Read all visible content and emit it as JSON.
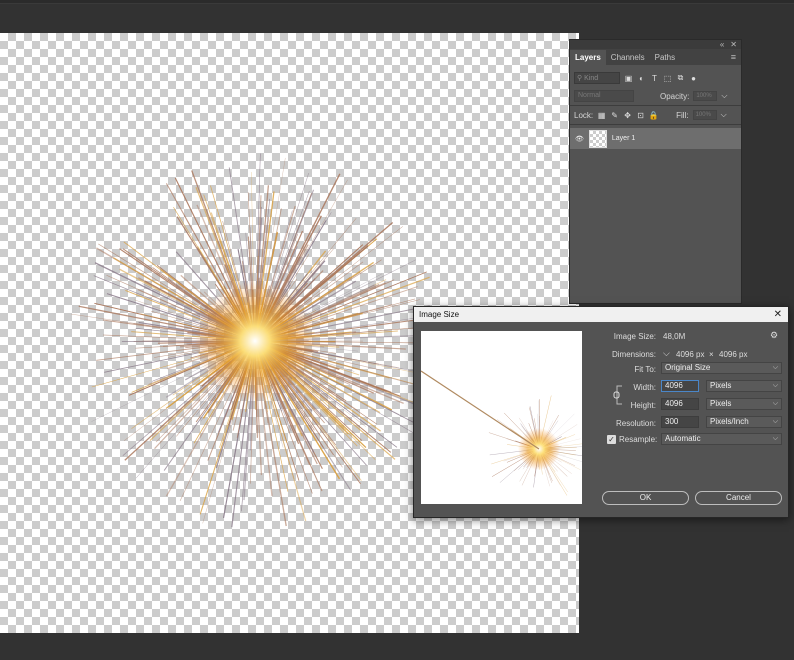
{
  "layers_panel": {
    "tabs": [
      "Layers",
      "Channels",
      "Paths"
    ],
    "kind_placeholder": "Kind",
    "blend_mode": "Normal",
    "opacity_label": "Opacity:",
    "opacity_value": "100%",
    "lock_label": "Lock:",
    "fill_label": "Fill:",
    "fill_value": "100%",
    "layer_name": "Layer 1"
  },
  "dialog": {
    "title": "Image Size",
    "image_size_label": "Image Size:",
    "image_size_value": "48,0M",
    "dimensions_label": "Dimensions:",
    "dimensions_w": "4096 px",
    "dimensions_x": "×",
    "dimensions_h": "4096 px",
    "fit_to_label": "Fit To:",
    "fit_to_value": "Original Size",
    "width_label": "Width:",
    "width_value": "4096",
    "width_unit": "Pixels",
    "height_label": "Height:",
    "height_value": "4096",
    "height_unit": "Pixels",
    "resolution_label": "Resolution:",
    "resolution_value": "300",
    "resolution_unit": "Pixels/Inch",
    "resample_label": "Resample:",
    "resample_value": "Automatic",
    "ok_label": "OK",
    "cancel_label": "Cancel"
  }
}
